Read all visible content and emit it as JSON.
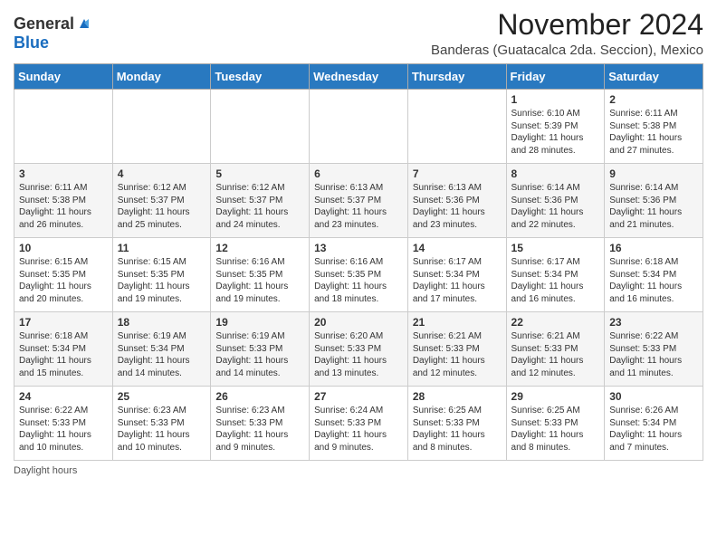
{
  "header": {
    "logo_general": "General",
    "logo_blue": "Blue",
    "month_title": "November 2024",
    "location": "Banderas (Guatacalca 2da. Seccion), Mexico"
  },
  "days_of_week": [
    "Sunday",
    "Monday",
    "Tuesday",
    "Wednesday",
    "Thursday",
    "Friday",
    "Saturday"
  ],
  "weeks": [
    [
      {
        "day": "",
        "info": ""
      },
      {
        "day": "",
        "info": ""
      },
      {
        "day": "",
        "info": ""
      },
      {
        "day": "",
        "info": ""
      },
      {
        "day": "",
        "info": ""
      },
      {
        "day": "1",
        "info": "Sunrise: 6:10 AM\nSunset: 5:39 PM\nDaylight: 11 hours and 28 minutes."
      },
      {
        "day": "2",
        "info": "Sunrise: 6:11 AM\nSunset: 5:38 PM\nDaylight: 11 hours and 27 minutes."
      }
    ],
    [
      {
        "day": "3",
        "info": "Sunrise: 6:11 AM\nSunset: 5:38 PM\nDaylight: 11 hours and 26 minutes."
      },
      {
        "day": "4",
        "info": "Sunrise: 6:12 AM\nSunset: 5:37 PM\nDaylight: 11 hours and 25 minutes."
      },
      {
        "day": "5",
        "info": "Sunrise: 6:12 AM\nSunset: 5:37 PM\nDaylight: 11 hours and 24 minutes."
      },
      {
        "day": "6",
        "info": "Sunrise: 6:13 AM\nSunset: 5:37 PM\nDaylight: 11 hours and 23 minutes."
      },
      {
        "day": "7",
        "info": "Sunrise: 6:13 AM\nSunset: 5:36 PM\nDaylight: 11 hours and 23 minutes."
      },
      {
        "day": "8",
        "info": "Sunrise: 6:14 AM\nSunset: 5:36 PM\nDaylight: 11 hours and 22 minutes."
      },
      {
        "day": "9",
        "info": "Sunrise: 6:14 AM\nSunset: 5:36 PM\nDaylight: 11 hours and 21 minutes."
      }
    ],
    [
      {
        "day": "10",
        "info": "Sunrise: 6:15 AM\nSunset: 5:35 PM\nDaylight: 11 hours and 20 minutes."
      },
      {
        "day": "11",
        "info": "Sunrise: 6:15 AM\nSunset: 5:35 PM\nDaylight: 11 hours and 19 minutes."
      },
      {
        "day": "12",
        "info": "Sunrise: 6:16 AM\nSunset: 5:35 PM\nDaylight: 11 hours and 19 minutes."
      },
      {
        "day": "13",
        "info": "Sunrise: 6:16 AM\nSunset: 5:35 PM\nDaylight: 11 hours and 18 minutes."
      },
      {
        "day": "14",
        "info": "Sunrise: 6:17 AM\nSunset: 5:34 PM\nDaylight: 11 hours and 17 minutes."
      },
      {
        "day": "15",
        "info": "Sunrise: 6:17 AM\nSunset: 5:34 PM\nDaylight: 11 hours and 16 minutes."
      },
      {
        "day": "16",
        "info": "Sunrise: 6:18 AM\nSunset: 5:34 PM\nDaylight: 11 hours and 16 minutes."
      }
    ],
    [
      {
        "day": "17",
        "info": "Sunrise: 6:18 AM\nSunset: 5:34 PM\nDaylight: 11 hours and 15 minutes."
      },
      {
        "day": "18",
        "info": "Sunrise: 6:19 AM\nSunset: 5:34 PM\nDaylight: 11 hours and 14 minutes."
      },
      {
        "day": "19",
        "info": "Sunrise: 6:19 AM\nSunset: 5:33 PM\nDaylight: 11 hours and 14 minutes."
      },
      {
        "day": "20",
        "info": "Sunrise: 6:20 AM\nSunset: 5:33 PM\nDaylight: 11 hours and 13 minutes."
      },
      {
        "day": "21",
        "info": "Sunrise: 6:21 AM\nSunset: 5:33 PM\nDaylight: 11 hours and 12 minutes."
      },
      {
        "day": "22",
        "info": "Sunrise: 6:21 AM\nSunset: 5:33 PM\nDaylight: 11 hours and 12 minutes."
      },
      {
        "day": "23",
        "info": "Sunrise: 6:22 AM\nSunset: 5:33 PM\nDaylight: 11 hours and 11 minutes."
      }
    ],
    [
      {
        "day": "24",
        "info": "Sunrise: 6:22 AM\nSunset: 5:33 PM\nDaylight: 11 hours and 10 minutes."
      },
      {
        "day": "25",
        "info": "Sunrise: 6:23 AM\nSunset: 5:33 PM\nDaylight: 11 hours and 10 minutes."
      },
      {
        "day": "26",
        "info": "Sunrise: 6:23 AM\nSunset: 5:33 PM\nDaylight: 11 hours and 9 minutes."
      },
      {
        "day": "27",
        "info": "Sunrise: 6:24 AM\nSunset: 5:33 PM\nDaylight: 11 hours and 9 minutes."
      },
      {
        "day": "28",
        "info": "Sunrise: 6:25 AM\nSunset: 5:33 PM\nDaylight: 11 hours and 8 minutes."
      },
      {
        "day": "29",
        "info": "Sunrise: 6:25 AM\nSunset: 5:33 PM\nDaylight: 11 hours and 8 minutes."
      },
      {
        "day": "30",
        "info": "Sunrise: 6:26 AM\nSunset: 5:34 PM\nDaylight: 11 hours and 7 minutes."
      }
    ]
  ],
  "footer": "Daylight hours"
}
